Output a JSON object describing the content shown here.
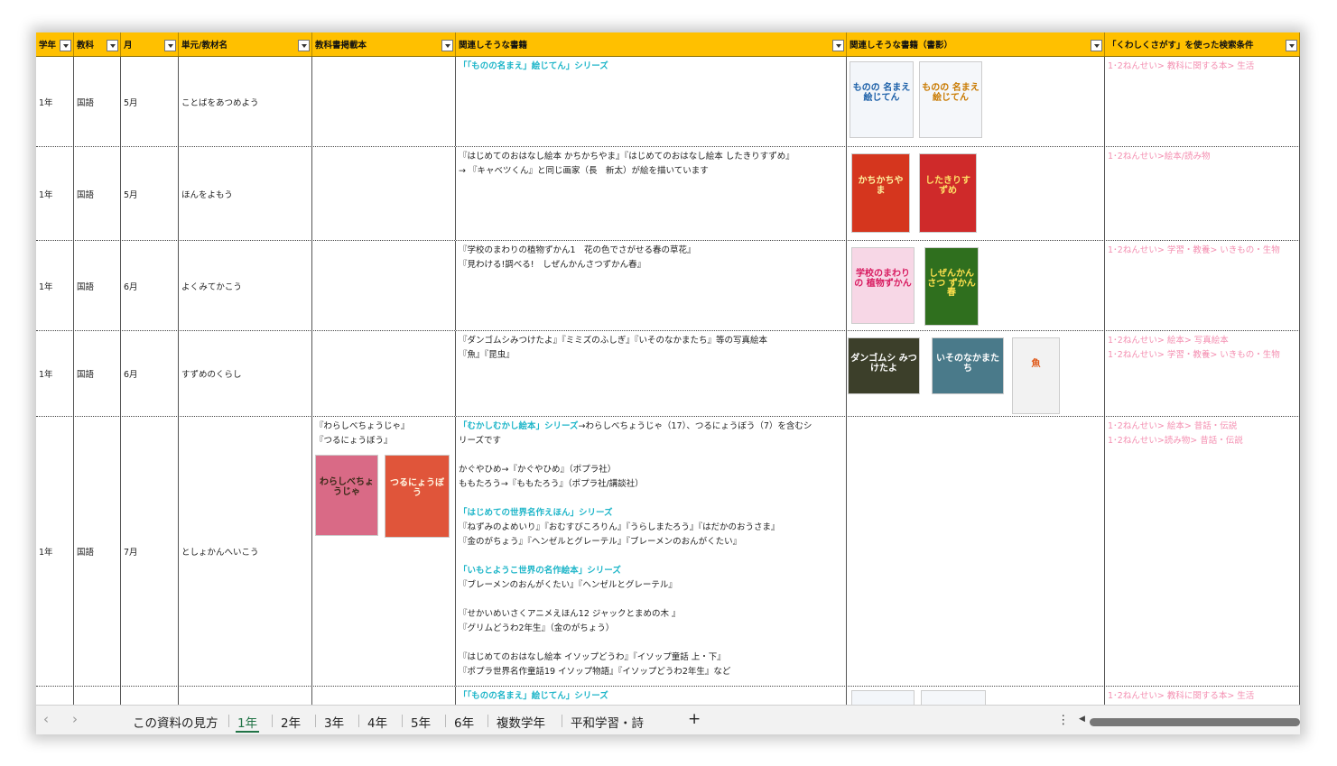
{
  "headers": [
    "学年",
    "教科",
    "月",
    "単元/教材名",
    "教科書掲載本",
    "関連しそうな書籍",
    "関連しそうな書籍（書影）",
    "「くわしくさがす」を使った検索条件"
  ],
  "rows": [
    {
      "grade": "1年",
      "subject": "国語",
      "month": "5月",
      "unit": "ことばをあつめよう",
      "textbook_books": [],
      "books": [
        {
          "text": "「「ものの名まえ」絵じてん」シリーズ",
          "series": true
        }
      ],
      "covers": [
        {
          "title": "ものの 名まえ 絵じてん",
          "bg": "#f3f6fa",
          "fg": "#1b5fa8"
        },
        {
          "title": "ものの 名まえ 絵じてん",
          "bg": "#f5f7fa",
          "fg": "#c97a00"
        }
      ],
      "search": [
        "1･2ねんせい> 教科に関する本> 生活"
      ]
    },
    {
      "grade": "1年",
      "subject": "国語",
      "month": "5月",
      "unit": "ほんをよもう",
      "textbook_books": [],
      "books": [
        {
          "text": "『はじめてのおはなし絵本 かちかちやま』『はじめてのおはなし絵本 したきりすずめ』"
        },
        {
          "text": "  → 『キャベツくん』と同じ画家（長　新太）が絵を描いています"
        }
      ],
      "covers": [
        {
          "title": "かちかちやま",
          "bg": "#d5361e",
          "fg": "#fff3a0"
        },
        {
          "title": "したきりすずめ",
          "bg": "#cf2a2a",
          "fg": "#ffe066"
        }
      ],
      "search": [
        "1･2ねんせい>絵本/読み物"
      ]
    },
    {
      "grade": "1年",
      "subject": "国語",
      "month": "6月",
      "unit": "よくみてかこう",
      "textbook_books": [],
      "books": [
        {
          "text": "『学校のまわりの植物ずかん1　花の色でさがせる春の草花』"
        },
        {
          "text": "『見わける!調べる!　しぜんかんさつずかん春』"
        }
      ],
      "covers": [
        {
          "title": "学校のまわりの 植物ずかん",
          "bg": "#f7d7e6",
          "fg": "#d81b60"
        },
        {
          "title": "しぜんかんさつ ずかん 春",
          "bg": "#2f6f1e",
          "fg": "#ffe14d"
        }
      ],
      "search": [
        "1･2ねんせい> 学習・教養> いきもの・生物"
      ]
    },
    {
      "grade": "1年",
      "subject": "国語",
      "month": "6月",
      "unit": "すずめのくらし",
      "textbook_books": [],
      "books": [
        {
          "text": "『ダンゴムシみつけたよ』『ミミズのふしぎ』『いそのなかまたち』等の写真絵本"
        },
        {
          "text": "『魚』『昆虫』"
        }
      ],
      "covers": [
        {
          "title": "ダンゴムシ みつけたよ",
          "bg": "#3c3f2a",
          "fg": "#ffffff"
        },
        {
          "title": "いそのなかまたち",
          "bg": "#4a7a8a",
          "fg": "#ffffff"
        },
        {
          "title": "魚",
          "bg": "#f2f2f2",
          "fg": "#e05a1a"
        }
      ],
      "search": [
        "1･2ねんせい> 絵本> 写真絵本",
        "1･2ねんせい> 学習・教養> いきもの・生物"
      ]
    },
    {
      "grade": "1年",
      "subject": "国語",
      "month": "7月",
      "unit": "としょかんへいこう",
      "textbook_books": [
        "『わらしべちょうじゃ』",
        "『つるにょうぼう』"
      ],
      "textbook_covers": [
        {
          "title": "わらしべちょうじゃ",
          "bg": "#d96a86",
          "fg": "#3a2a18"
        },
        {
          "title": "つるにょうぼう",
          "bg": "#e0553a",
          "fg": "#fff5e0"
        }
      ],
      "books": [
        {
          "text": "「むかしむかし絵本」シリーズ",
          "series": true,
          "tail": "→わらしべちょうじゃ（17）、つるにょうぼう（7）を含むシ"
        },
        {
          "text": "リーズです"
        },
        {
          "text": ""
        },
        {
          "text": "かぐやひめ→『かぐやひめ』（ポプラ社）"
        },
        {
          "text": "ももたろう→『ももたろう』（ポプラ社/講談社）"
        },
        {
          "text": ""
        },
        {
          "text": "「はじめての世界名作えほん」シリーズ",
          "series": true
        },
        {
          "text": "『ねずみのよめいり』『おむすびころりん』『うらしまたろう』『はだかのおうさま』"
        },
        {
          "text": "『金のがちょう』『ヘンゼルとグレーテル』『ブレーメンのおんがくたい』"
        },
        {
          "text": ""
        },
        {
          "text": "「いもとようこ世界の名作絵本」シリーズ",
          "series": true
        },
        {
          "text": "『ブレーメンのおんがくたい』『ヘンゼルとグレーテル』"
        },
        {
          "text": ""
        },
        {
          "text": "『せかいめいさくアニメえほん12 ジャックとまめの木 』"
        },
        {
          "text": "『グリムどうわ2年生』（金のがちょう）"
        },
        {
          "text": ""
        },
        {
          "text": "『はじめてのおはなし絵本 イソップどうわ』『イソップ童話 上・下』"
        },
        {
          "text": "『ポプラ世界名作童話19 イソップ物語』『イソップどうわ2年生』など"
        }
      ],
      "covers": [],
      "search": [
        "1･2ねんせい> 絵本> 昔話・伝説",
        "1･2ねんせい>読み物> 昔話・伝説"
      ]
    },
    {
      "grade": "",
      "subject": "",
      "month": "",
      "unit": "",
      "textbook_books": [],
      "books": [
        {
          "text": "「「ものの名まえ」絵じてん」シリーズ",
          "series": true
        }
      ],
      "covers": [
        {
          "title": "",
          "bg": "#f3f6fa",
          "fg": "#1b5fa8"
        },
        {
          "title": "",
          "bg": "#f5f7fa",
          "fg": "#c97a00"
        }
      ],
      "search": [
        "1･2ねんせい> 教科に関する本> 生活"
      ]
    }
  ],
  "tabs": [
    "この資料の見方",
    "1年",
    "2年",
    "3年",
    "4年",
    "5年",
    "6年",
    "複数学年",
    "平和学習・詩"
  ],
  "active_tab": "1年",
  "add_sheet": "+",
  "nav_prev": "‹",
  "nav_next": "›",
  "more": "⋮",
  "scroll_left": "◀"
}
